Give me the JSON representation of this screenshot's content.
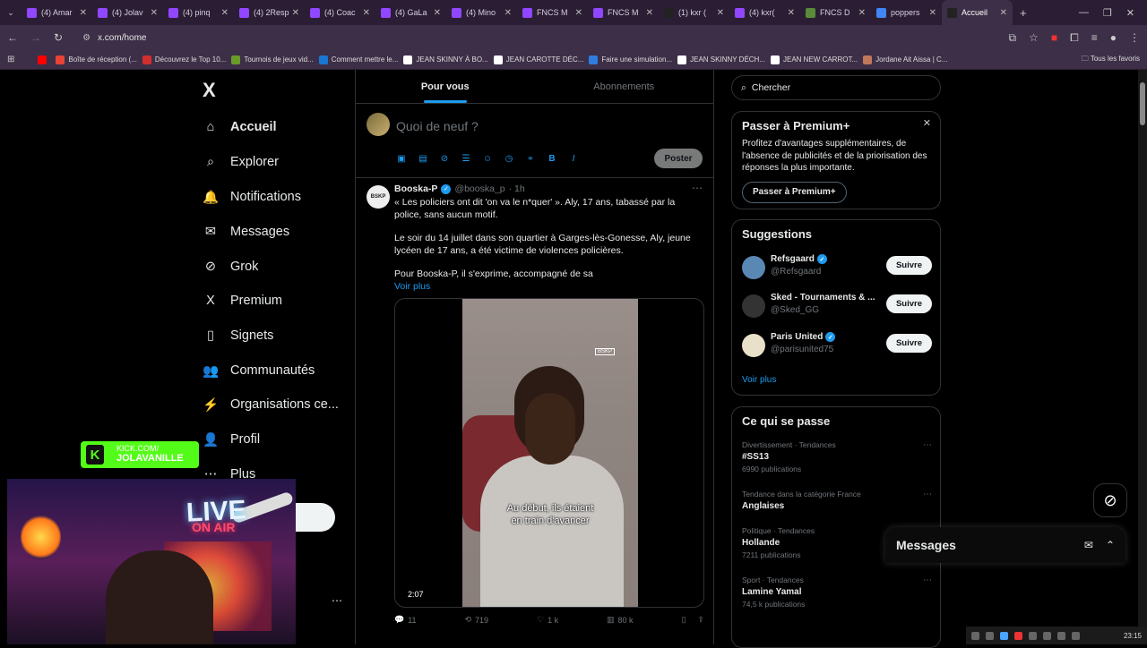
{
  "browser": {
    "tabs": [
      {
        "title": "(4) Amar",
        "color": "#9146ff"
      },
      {
        "title": "(4) Jolav",
        "color": "#9146ff"
      },
      {
        "title": "(4) pinq",
        "color": "#9146ff"
      },
      {
        "title": "(4) 2Resp",
        "color": "#9146ff"
      },
      {
        "title": "(4) Coac",
        "color": "#9146ff"
      },
      {
        "title": "(4) GaLa",
        "color": "#9146ff"
      },
      {
        "title": "(4) Mino",
        "color": "#9146ff"
      },
      {
        "title": "FNCS M",
        "color": "#9146ff"
      },
      {
        "title": "FNCS M",
        "color": "#9146ff"
      },
      {
        "title": "(1) kxr (",
        "color": "#222222"
      },
      {
        "title": "(4) kxr(",
        "color": "#9146ff"
      },
      {
        "title": "FNCS D",
        "color": "#5a8a3a"
      },
      {
        "title": "poppers",
        "color": "#4285f4"
      },
      {
        "title": "Accueil",
        "color": "#222222"
      }
    ],
    "url": "x.com/home",
    "bookmarks": [
      {
        "label": "",
        "color": "#ff0000"
      },
      {
        "label": "Boîte de réception (...",
        "color": "#ea4335"
      },
      {
        "label": "Découvrez le Top 10...",
        "color": "#d32f2f"
      },
      {
        "label": "Tournois de jeux vid...",
        "color": "#6a9a2a"
      },
      {
        "label": "Comment mettre le...",
        "color": "#1976d2"
      },
      {
        "label": "JEAN SKINNY À BO...",
        "color": "#ffffff"
      },
      {
        "label": "JEAN CAROTTE DÉC...",
        "color": "#ffffff"
      },
      {
        "label": "Faire une simulation...",
        "color": "#2f7de1"
      },
      {
        "label": "JEAN SKINNY DÉCH...",
        "color": "#ffffff"
      },
      {
        "label": "JEAN NEW CARROT...",
        "color": "#ffffff"
      },
      {
        "label": "Jordane Ait Aissa | C...",
        "color": "#c0785a"
      }
    ],
    "all_favorites": "Tous les favoris"
  },
  "nav": {
    "logo": "X",
    "items": [
      {
        "label": "Accueil",
        "icon": "home-icon",
        "glyph": "⌂"
      },
      {
        "label": "Explorer",
        "icon": "search-icon",
        "glyph": "⌕"
      },
      {
        "label": "Notifications",
        "icon": "bell-icon",
        "glyph": "🔔"
      },
      {
        "label": "Messages",
        "icon": "envelope-icon",
        "glyph": "✉"
      },
      {
        "label": "Grok",
        "icon": "grok-icon",
        "glyph": "⊘"
      },
      {
        "label": "Premium",
        "icon": "x-premium-icon",
        "glyph": "X"
      },
      {
        "label": "Signets",
        "icon": "bookmark-icon",
        "glyph": "▯"
      },
      {
        "label": "Communautés",
        "icon": "communities-icon",
        "glyph": "👥"
      },
      {
        "label": "Organisations ce...",
        "icon": "lightning-icon",
        "glyph": "⚡"
      },
      {
        "label": "Profil",
        "icon": "profile-icon",
        "glyph": "👤"
      },
      {
        "label": "Plus",
        "icon": "more-circle-icon",
        "glyph": "⋯"
      }
    ]
  },
  "feed": {
    "tabs": [
      "Pour vous",
      "Abonnements"
    ],
    "compose_placeholder": "Quoi de neuf ?",
    "post_button": "Poster",
    "tweet": {
      "avatar_text": "BSKP",
      "name": "Booska-P",
      "handle": "@booska_p",
      "time": "· 1h",
      "para1": "« Les policiers ont dit 'on va le n*quer' ». Aly, 17 ans, tabassé par la police, sans aucun motif.",
      "para2": "Le soir du 14 juillet dans son quartier à Garges-lès-Gonesse, Aly, jeune lycéen de 17 ans, a été victime de violences policières.",
      "para3": "Pour Booska-P, il s'exprime, accompagné de sa",
      "see_more": "Voir plus",
      "video_watermark": "BSKP",
      "subtitle1": "Au début, ils étaient",
      "subtitle2": "en train d'avancer",
      "duration": "2:07",
      "replies": "11",
      "reposts": "719",
      "likes": "1 k",
      "views": "80 k"
    }
  },
  "right": {
    "search_placeholder": "Chercher",
    "premium": {
      "title": "Passer à Premium+",
      "text": "Profitez d'avantages supplémentaires, de l'absence de publicités et de la priorisation des réponses la plus importante.",
      "button": "Passer à Premium+"
    },
    "suggestions": {
      "title": "Suggestions",
      "items": [
        {
          "name": "Refsgaard",
          "handle": "@Refsgaard",
          "verified": true,
          "follow": "Suivre",
          "color": "#5a88b5"
        },
        {
          "name": "Sked - Tournaments & ...",
          "handle": "@Sked_GG",
          "verified": false,
          "follow": "Suivre",
          "color": "#333333"
        },
        {
          "name": "Paris United",
          "handle": "@parisunited75",
          "verified": true,
          "follow": "Suivre",
          "color": "#e8e0c8"
        }
      ],
      "see_more": "Voir plus"
    },
    "trends": {
      "title": "Ce qui se passe",
      "items": [
        {
          "category": "Divertissement · Tendances",
          "name": "#SS13",
          "posts": "6990 publications"
        },
        {
          "category": "Tendance dans la catégorie France",
          "name": "Anglaises",
          "posts": ""
        },
        {
          "category": "Politique · Tendances",
          "name": "Hollande",
          "posts": "7211 publications"
        },
        {
          "category": "Sport · Tendances",
          "name": "Lamine Yamal",
          "posts": "74,5 k publications"
        }
      ]
    }
  },
  "messages_dock": {
    "title": "Messages"
  },
  "overlay": {
    "kick_line1": "KICK.COM/",
    "kick_line2": "JOLAVANILLE",
    "live": "LIVE",
    "on_air": "ON AIR"
  },
  "taskbar": {
    "clock": "23:15"
  }
}
